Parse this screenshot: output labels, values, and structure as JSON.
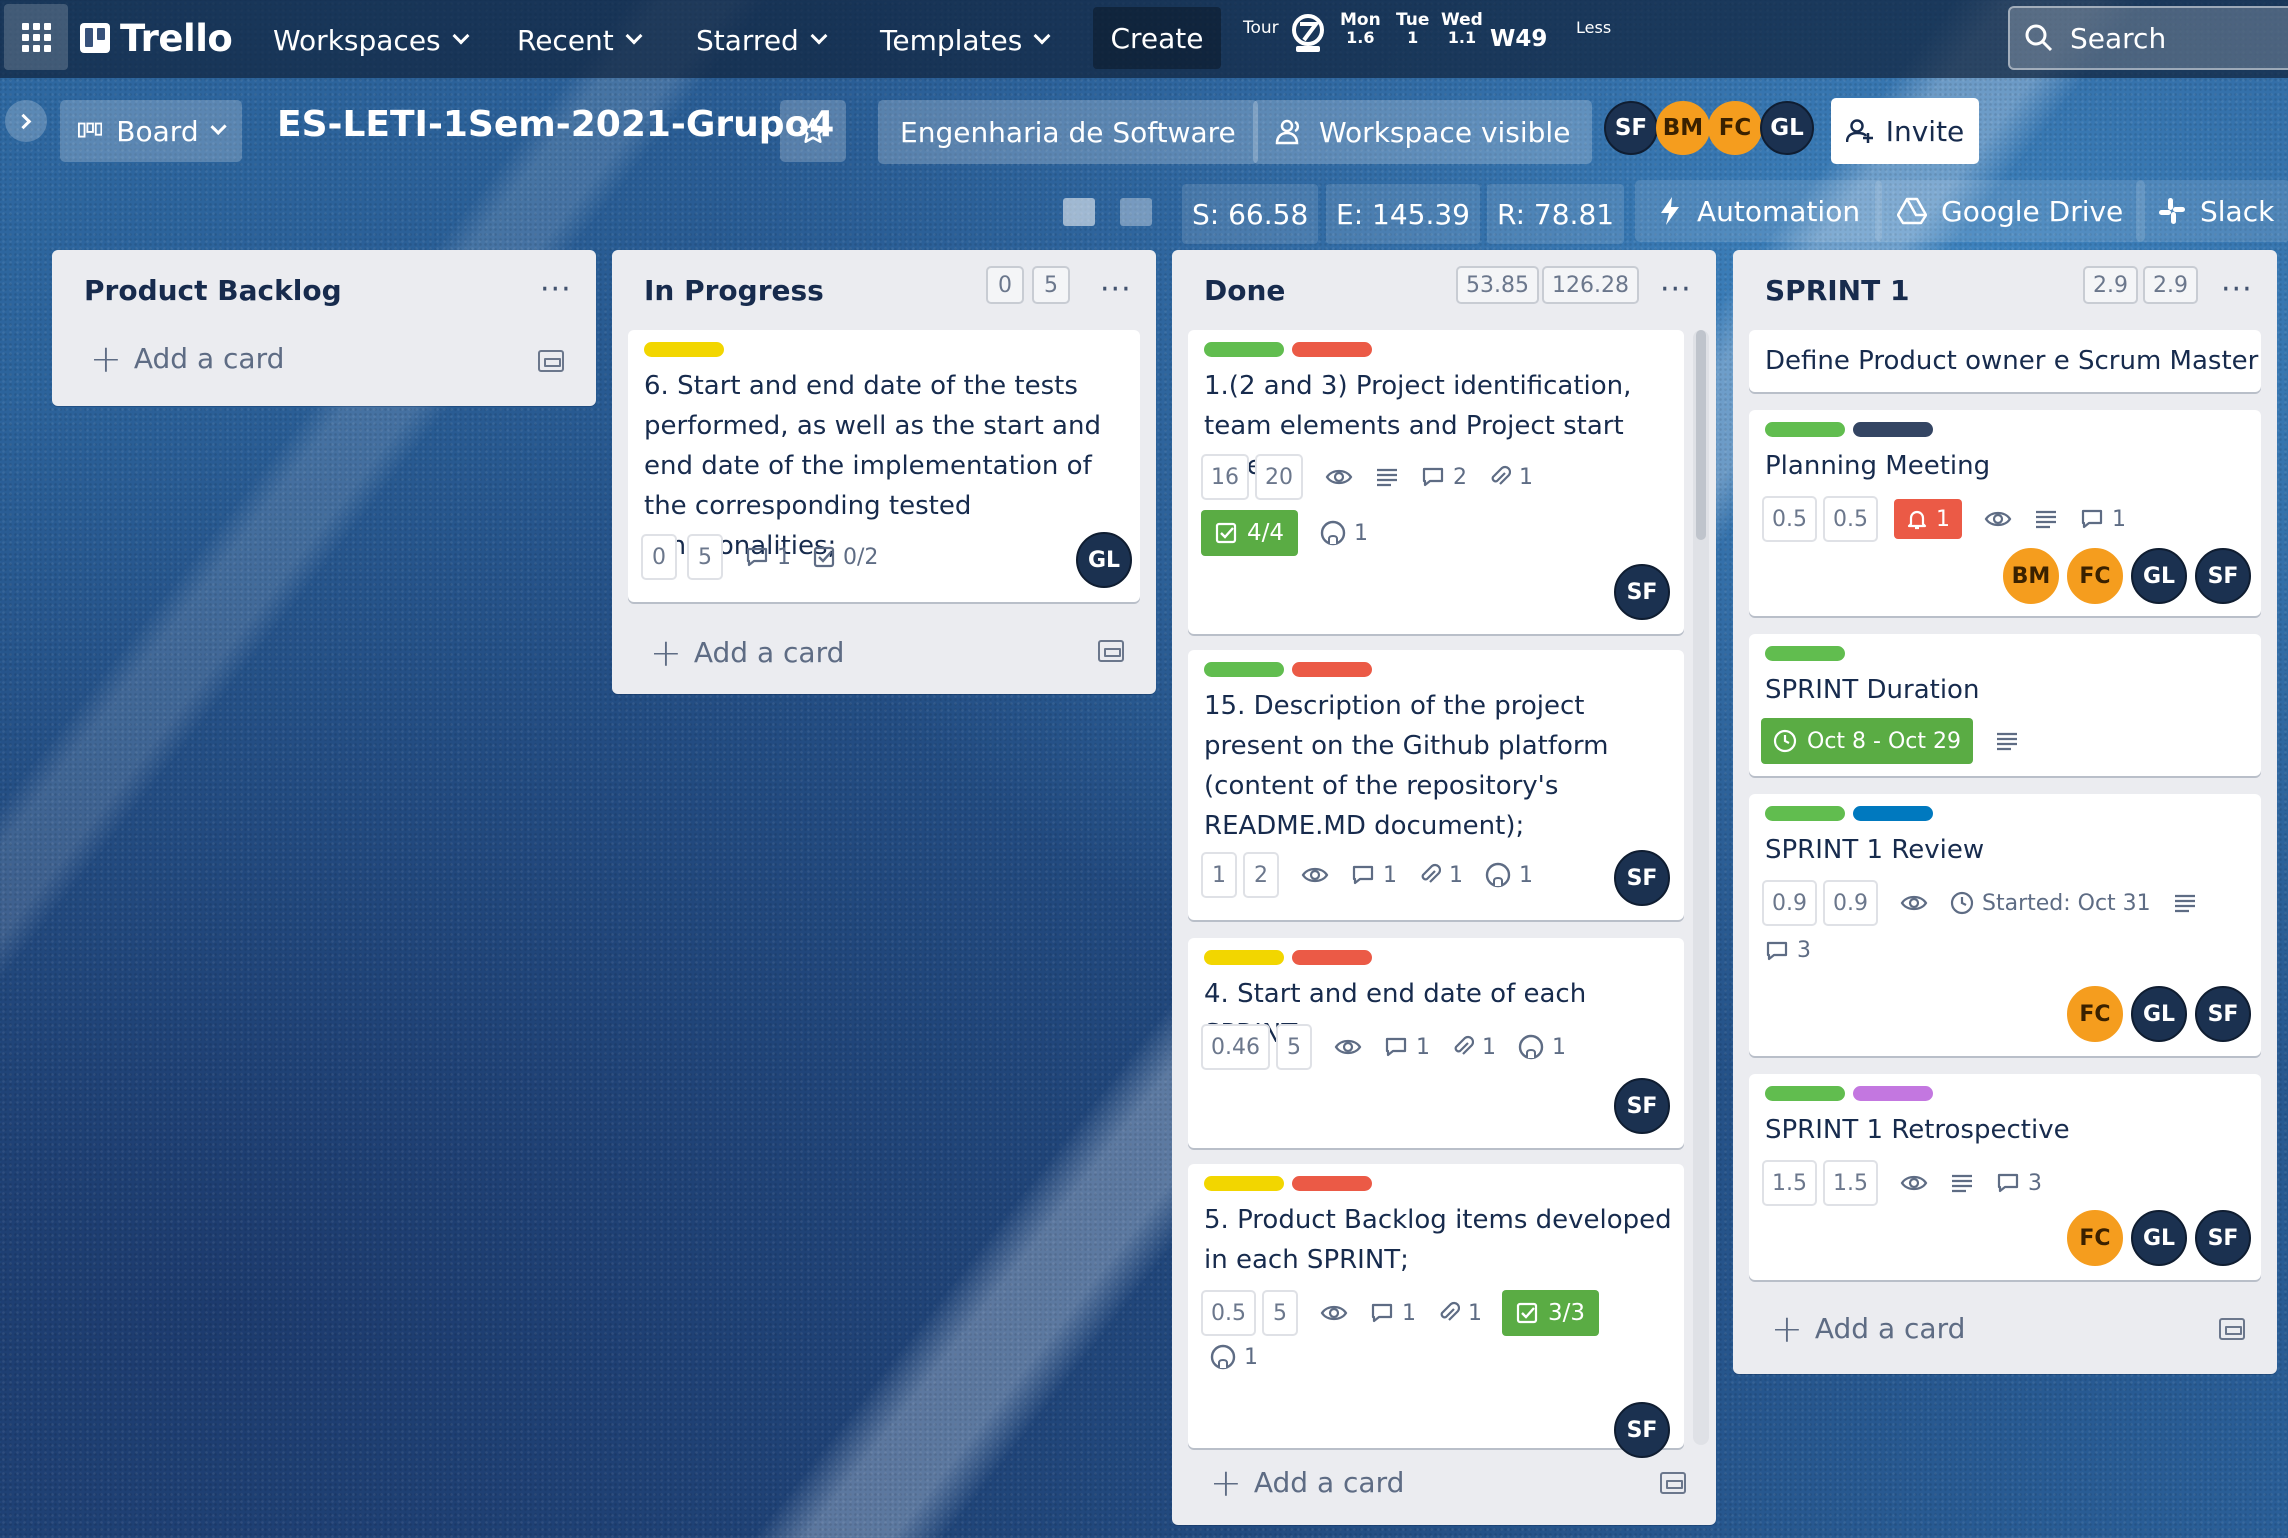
{
  "topnav": {
    "logo": "Trello",
    "menus": [
      "Workspaces",
      "Recent",
      "Starred",
      "Templates"
    ],
    "create": "Create",
    "tour": {
      "label": "Tour",
      "mon_label": "Mon",
      "mon_val": "1.6",
      "tue_label": "Tue",
      "tue_val": "1",
      "wed_label": "Wed",
      "wed_val": "1.1",
      "week": "W49",
      "less": "Less"
    },
    "search": "Search"
  },
  "board": {
    "view": "Board",
    "title": "ES-LETI-1Sem-2021-Grupo4",
    "workspace": "Engenharia de Software",
    "visibility": "Workspace visible",
    "members": [
      "SF",
      "BM",
      "FC",
      "GL"
    ],
    "invite": "Invite",
    "stats": {
      "s": "S: 66.58",
      "e": "E: 145.39",
      "r": "R: 78.81"
    },
    "powerups": {
      "automation": "Automation",
      "drive": "Google Drive",
      "slack": "Slack"
    }
  },
  "lists": {
    "backlog": {
      "title": "Product Backlog",
      "add": "Add a card",
      "menu": "···"
    },
    "progress": {
      "title": "In Progress",
      "b1": "0",
      "b2": "5",
      "add": "Add a card",
      "menu": "···",
      "cards": [
        {
          "title": "6. Start and end date of the tests performed, as well as the start and end date of the implementation of the corresponding tested functionalities;",
          "n1": "0",
          "n2": "5",
          "comments": "1",
          "checklist": "0/2",
          "avatar": "GL"
        }
      ]
    },
    "done": {
      "title": "Done",
      "b1": "53.85",
      "b2": "126.28",
      "add": "Add a card",
      "menu": "···",
      "cards": [
        {
          "title": "1.(2 and 3) Project identification, team elements and Project start date;",
          "n1": "16",
          "n2": "20",
          "comments": "2",
          "attach": "1",
          "checklist": "4/4",
          "github": "1",
          "avatar": "SF"
        },
        {
          "title": "15. Description of the project present on the Github platform (content of the repository's README.MD document);",
          "n1": "1",
          "n2": "2",
          "comments": "1",
          "attach": "1",
          "github": "1",
          "avatar": "SF"
        },
        {
          "title": "4. Start and end date of each SPRINT;",
          "n1": "0.46",
          "n2": "5",
          "comments": "1",
          "attach": "1",
          "github": "1",
          "avatar": "SF"
        },
        {
          "title": "5. Product Backlog items developed in each SPRINT;",
          "n1": "0.5",
          "n2": "5",
          "comments": "1",
          "attach": "1",
          "checklist": "3/3",
          "github": "1",
          "avatar": "SF"
        }
      ]
    },
    "sprint": {
      "title": "SPRINT 1",
      "b1": "2.9",
      "b2": "2.9",
      "add": "Add a card",
      "menu": "···",
      "cards": [
        {
          "title": "Define Product owner e Scrum Master"
        },
        {
          "title": "Planning Meeting",
          "n1": "0.5",
          "n2": "0.5",
          "alert": "1",
          "comments": "1",
          "avatars": [
            "BM",
            "FC",
            "GL",
            "SF"
          ]
        },
        {
          "title": "SPRINT Duration",
          "date": "Oct 8 - Oct 29"
        },
        {
          "title": "SPRINT 1 Review",
          "n1": "0.9",
          "n2": "0.9",
          "started": "Started: Oct 31",
          "comments": "3",
          "avatars": [
            "FC",
            "GL",
            "SF"
          ]
        },
        {
          "title": "SPRINT 1 Retrospective",
          "n1": "1.5",
          "n2": "1.5",
          "comments": "3",
          "avatars": [
            "FC",
            "GL",
            "SF"
          ]
        }
      ]
    }
  },
  "colors": {
    "green": "#61bd4f",
    "red": "#eb5a46",
    "yellow": "#f2d600",
    "navy": "#344563",
    "blue": "#0079bf",
    "purple": "#c377e0"
  }
}
